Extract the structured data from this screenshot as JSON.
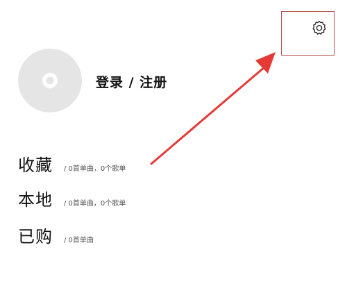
{
  "header": {
    "settings_icon": "gear-icon",
    "highlight_color": "#b44a4a"
  },
  "profile": {
    "avatar_icon": "user-avatar-icon",
    "login_label": "登录 / 注册"
  },
  "menu": {
    "items": [
      {
        "title": "收藏",
        "subtitle": "/ 0首单曲，0个歌单"
      },
      {
        "title": "本地",
        "subtitle": "/ 0首单曲，0个歌单"
      },
      {
        "title": "已购",
        "subtitle": "/ 0首单曲"
      }
    ]
  },
  "annotation": {
    "arrow_color": "#e53935"
  }
}
